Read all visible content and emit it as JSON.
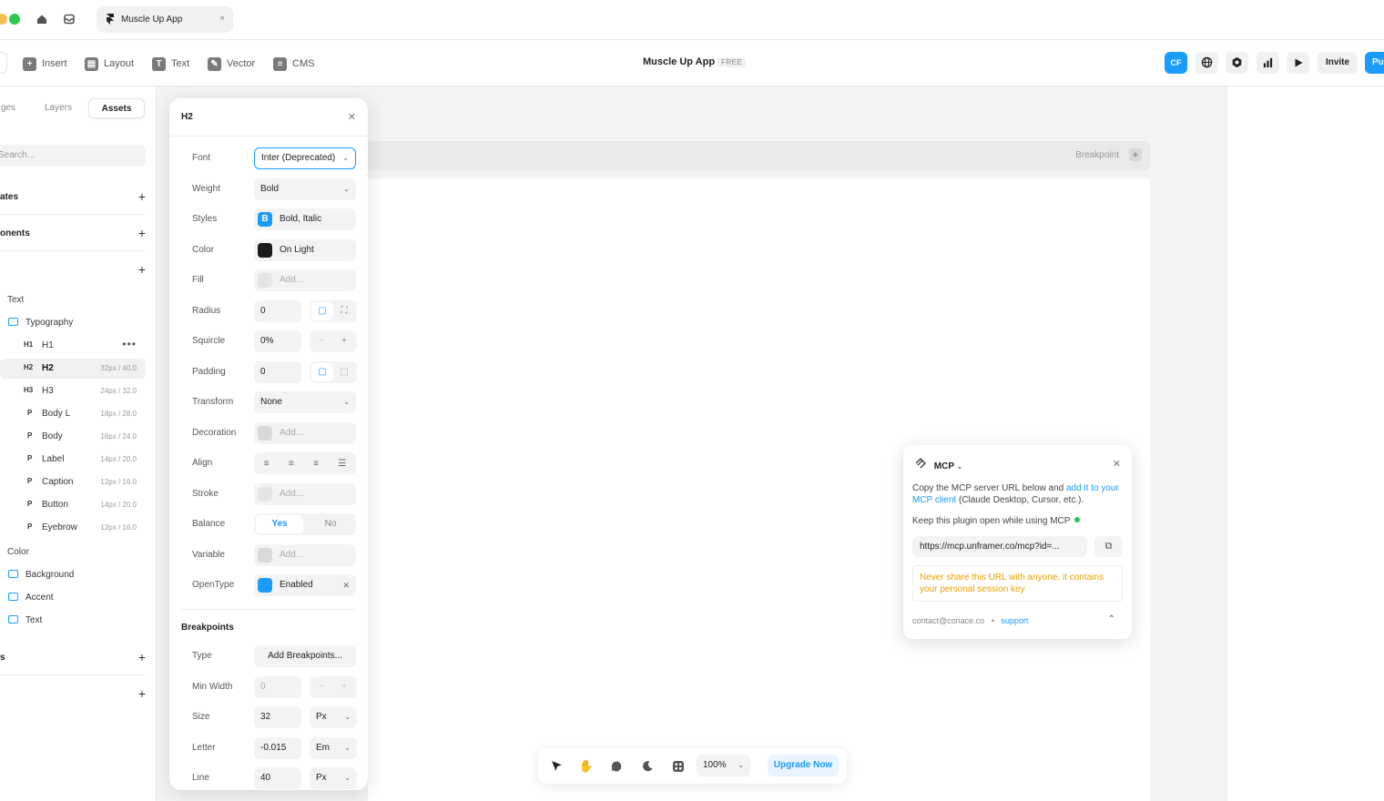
{
  "colors": {
    "accent": "#1a9bff",
    "warning": "#e8a100",
    "live": "#23c45e"
  },
  "window": {
    "home_icon": "home-icon",
    "inbox_icon": "inbox-icon",
    "tab": {
      "title": "Muscle Up App",
      "close": "×"
    }
  },
  "toolbar": {
    "items": [
      {
        "label": "Insert",
        "icon": "plus-icon"
      },
      {
        "label": "Layout",
        "icon": "layout-icon"
      },
      {
        "label": "Text",
        "icon": "text-icon"
      },
      {
        "label": "Vector",
        "icon": "vector-icon"
      },
      {
        "label": "CMS",
        "icon": "database-icon"
      }
    ],
    "project_title": "Muscle Up App",
    "plan_badge": "FREE",
    "avatar": "CF",
    "invite": "Invite",
    "publish": "Pu"
  },
  "sidebar": {
    "tabs": [
      "ges",
      "Layers",
      "Assets"
    ],
    "search_placeholder": "Search...",
    "sections": [
      "ates",
      "onents",
      ""
    ],
    "text_group": "Text",
    "typography_folder": "Typography",
    "styles": [
      {
        "tag": "H1",
        "name": "H1",
        "meta": ""
      },
      {
        "tag": "H2",
        "name": "H2",
        "meta": "32px / 40.0"
      },
      {
        "tag": "H3",
        "name": "H3",
        "meta": "24px / 32.0"
      },
      {
        "tag": "P",
        "name": "Body L",
        "meta": "18px / 28.0"
      },
      {
        "tag": "P",
        "name": "Body",
        "meta": "16px / 24.0"
      },
      {
        "tag": "P",
        "name": "Label",
        "meta": "14px / 20.0"
      },
      {
        "tag": "P",
        "name": "Caption",
        "meta": "12px / 16.0"
      },
      {
        "tag": "P",
        "name": "Button",
        "meta": "14px / 20.0"
      },
      {
        "tag": "P",
        "name": "Eyebrow",
        "meta": "12px / 16.0"
      }
    ],
    "color_group": "Color",
    "color_folders": [
      "Background",
      "Accent",
      "Text"
    ],
    "bottom_sections": [
      "s",
      ""
    ]
  },
  "canvas": {
    "breakpoint_label": "Breakpoint"
  },
  "inspector": {
    "title": "H2",
    "font": {
      "label": "Font",
      "value": "Inter (Deprecated)"
    },
    "weight": {
      "label": "Weight",
      "value": "Bold"
    },
    "styles": {
      "label": "Styles",
      "value": "Bold, Italic",
      "badge": "B"
    },
    "color": {
      "label": "Color",
      "value": "On Light",
      "swatch": "#1a1a1a"
    },
    "fill": {
      "label": "Fill",
      "placeholder": "Add..."
    },
    "radius": {
      "label": "Radius",
      "value": "0"
    },
    "squircle": {
      "label": "Squircle",
      "value": "0%"
    },
    "padding": {
      "label": "Padding",
      "value": "0"
    },
    "transform": {
      "label": "Transform",
      "value": "None"
    },
    "decoration": {
      "label": "Decoration",
      "placeholder": "Add..."
    },
    "align": {
      "label": "Align"
    },
    "stroke": {
      "label": "Stroke",
      "placeholder": "Add..."
    },
    "balance": {
      "label": "Balance",
      "yes": "Yes",
      "no": "No"
    },
    "variable": {
      "label": "Variable",
      "placeholder": "Add..."
    },
    "opentype": {
      "label": "OpenType",
      "value": "Enabled"
    },
    "breakpoints_title": "Breakpoints",
    "type": {
      "label": "Type",
      "value": "Add Breakpoints..."
    },
    "min_width": {
      "label": "Min Width",
      "value": "0"
    },
    "size": {
      "label": "Size",
      "value": "32",
      "unit": "Px"
    },
    "letter": {
      "label": "Letter",
      "value": "-0.015",
      "unit": "Em"
    },
    "line": {
      "label": "Line",
      "value": "40",
      "unit": "Px"
    }
  },
  "mcp": {
    "title": "MCP",
    "text_before_link": "Copy the MCP server URL below and ",
    "link": "add it to your MCP client",
    "text_after_link": " (Claude Desktop, Cursor, etc.).",
    "keep_open": "Keep this plugin open while using MCP",
    "url": "https://mcp.unframer.co/mcp?id=...",
    "warning": "Never share this URL with anyone, it contains your personal session key",
    "contact": "contact@coriace.co",
    "separator": "•",
    "support": "support"
  },
  "bottom_bar": {
    "zoom": "100%",
    "upgrade": "Upgrade Now"
  }
}
